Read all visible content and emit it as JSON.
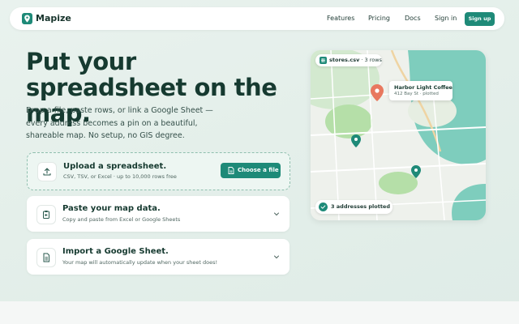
{
  "brand": {
    "name": "Mapize",
    "color": "#1e8a78"
  },
  "nav": {
    "links": [
      "Features",
      "Pricing",
      "Docs"
    ],
    "sign_in": "Sign in",
    "sign_up": "Sign up"
  },
  "hero": {
    "title": "Put your spreadsheet on the map.",
    "subtitle": "Drop a file, paste rows, or link a Google Sheet — every address becomes a pin on a beautiful, shareable map. No setup, no GIS degree."
  },
  "options": [
    {
      "title": "Upload a spreadsheet.",
      "description": "CSV, TSV, or Excel · up to 10,000 rows free",
      "button": "Choose a file",
      "icon": "upload-icon"
    },
    {
      "title": "Paste your map data.",
      "description": "Copy and paste from Excel or Google Sheets",
      "icon": "paste-icon"
    },
    {
      "title": "Import a Google Sheet.",
      "description": "Your map will automatically update when your sheet does!",
      "icon": "sheet-icon"
    }
  ],
  "map": {
    "file_chip": {
      "filename": "stores.csv",
      "meta": " · 3 rows"
    },
    "popup": {
      "name": "Harbor Light Coffee",
      "detail": "412 Bay St · plotted"
    },
    "status": "3 addresses plotted",
    "pin_colors": {
      "selected": "#e8785f",
      "default": "#1e8a78"
    }
  }
}
